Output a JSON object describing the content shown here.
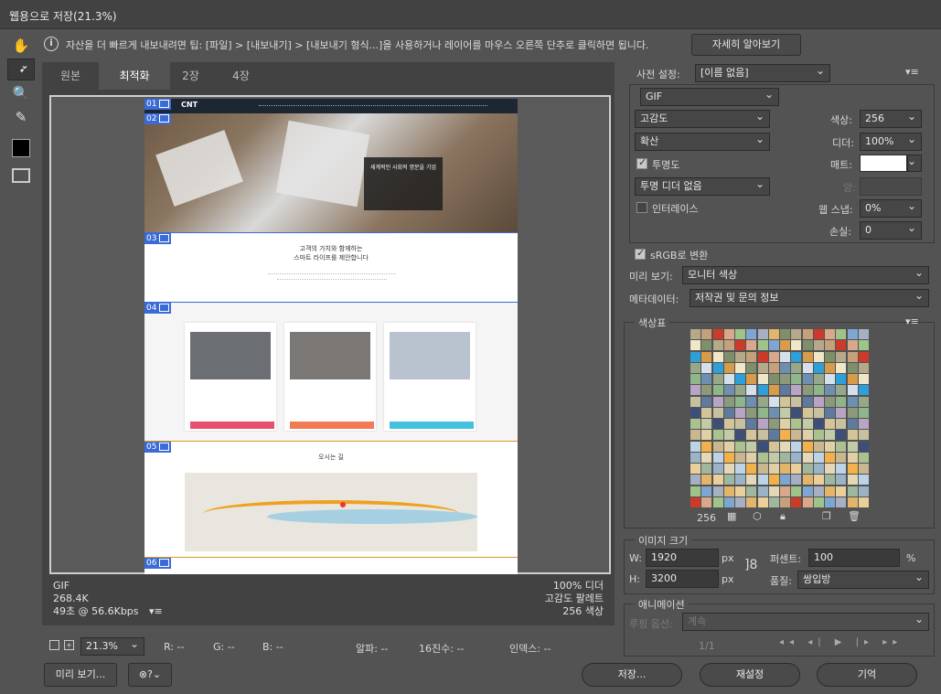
{
  "window": {
    "title": "웹용으로 저장(21.3%)"
  },
  "info": {
    "text": "자산을 더 빠르게 내보내려면 팁: [파일] > [내보내기] > [내보내기 형식...]을 사용하거나 레이어를 마우스 오른쪽 단추로 클릭하면 됩니다.",
    "learn_more": "자세히 알아보기"
  },
  "tabs": [
    "원본",
    "최적화",
    "2장",
    "4장"
  ],
  "preview": {
    "logo": "CNT",
    "slices": [
      "01",
      "02",
      "03",
      "04",
      "05",
      "06"
    ],
    "hero_text": "세계적인 사회적 명분을 기업",
    "sec3_title": "고객의 가치와 함께하는",
    "sec3_sub": "스마트 라이프를 제안합니다",
    "sec5_title": "오시는 길"
  },
  "stats": {
    "format": "GIF",
    "size": "268.4K",
    "time": "49초 @ 56.6Kbps",
    "dither": "100% 디더",
    "palette": "고감도 팔레트",
    "colors": "256 색상"
  },
  "status": {
    "zoom": "21.3%",
    "r": "R: --",
    "g": "G: --",
    "b": "B: --",
    "alpha": "알파: --",
    "hex": "16진수: --",
    "index": "인덱스: --"
  },
  "right": {
    "preset_label": "사전 설정:",
    "preset_value": "[이름 없음]",
    "format": "GIF",
    "reduction": "고감도",
    "colors_label": "색상:",
    "colors_value": "256",
    "dither_algo": "확산",
    "dither_label": "디더:",
    "dither_value": "100%",
    "transparency": "투명도",
    "matte_label": "매트:",
    "trans_dither": "투명 디더 없음",
    "amount_label": "양:",
    "interlace": "인터레이스",
    "web_snap_label": "웹 스냅:",
    "web_snap_value": "0%",
    "lossy_label": "손실:",
    "lossy_value": "0",
    "srgb": "sRGB로 변환",
    "preview_label": "미리 보기:",
    "preview_value": "모니터 색상",
    "metadata_label": "메타데이터:",
    "metadata_value": "저작권 및 문의 정보",
    "color_table": "색상표",
    "color_count": "256",
    "image_size": "이미지 크기",
    "w_label": "W:",
    "w_value": "1920",
    "h_label": "H:",
    "h_value": "3200",
    "px": "px",
    "percent_label": "퍼센트:",
    "percent_value": "100",
    "pct": "%",
    "quality_label": "품질:",
    "quality_value": "쌍입방",
    "animation": "애니메이션",
    "loop_label": "루핑 옵션:",
    "loop_value": "계속",
    "frame": "1/1"
  },
  "buttons": {
    "preview": "미리 보기...",
    "save": "저장...",
    "reset": "재설정",
    "remember": "기억"
  }
}
